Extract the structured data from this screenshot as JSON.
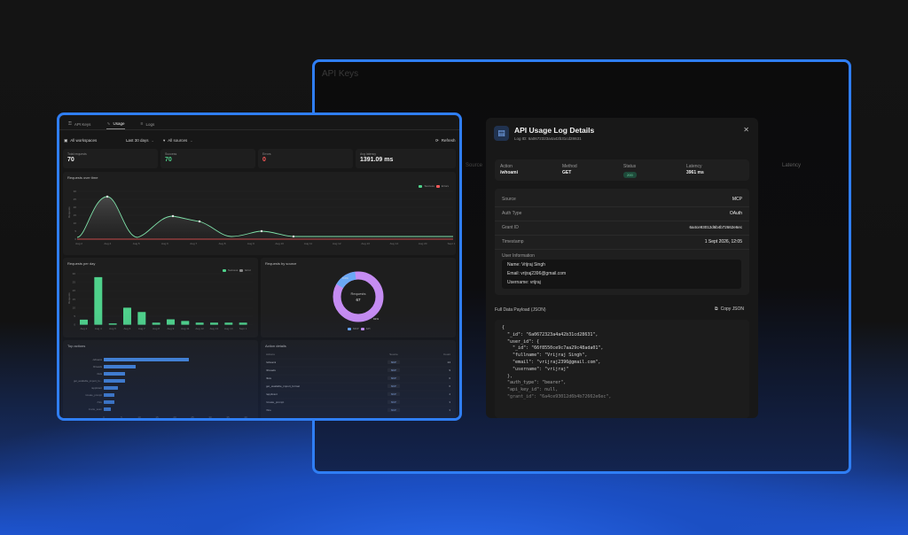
{
  "back_window": {
    "title": "API Keys",
    "source_header": "Source",
    "latency_header": "Latency"
  },
  "dashboard": {
    "tabs": [
      {
        "label": "API Keys",
        "icon": "key-icon"
      },
      {
        "label": "Usage",
        "icon": "chart-icon"
      },
      {
        "label": "Logs",
        "icon": "list-icon"
      }
    ],
    "filters": {
      "workspace": "All workspaces",
      "period": "Last 30 days",
      "sources": "All sources",
      "refresh": "Refresh"
    },
    "stats": [
      {
        "label": "Total requests",
        "value": "70"
      },
      {
        "label": "Success",
        "value": "70",
        "color": "#4fd18b"
      },
      {
        "label": "Errors",
        "value": "0",
        "color": "#ff5a5a"
      },
      {
        "label": "Avg latency",
        "value": "1391.09 ms"
      }
    ],
    "requests_over_time": {
      "title": "Requests over time",
      "legend": [
        "Success",
        "Errors"
      ],
      "ylabel": "Requests",
      "yticks": [
        "30",
        "25",
        "20",
        "15",
        "10",
        "5",
        "0"
      ],
      "xticks": [
        "Aug 2",
        "Aug 4",
        "Aug 5",
        "Aug 6",
        "Aug 7",
        "Aug 8",
        "Aug 9",
        "Aug 10",
        "Aug 11",
        "Aug 12",
        "Aug 13",
        "Aug 14",
        "Aug 20",
        "Sept 1"
      ]
    },
    "requests_per_day": {
      "title": "Requests per day",
      "legend": [
        "Success",
        "Error"
      ],
      "ylabel": "Requests",
      "yticks": [
        "30",
        "25",
        "20",
        "15",
        "10",
        "5",
        "0"
      ],
      "xticks": [
        "Aug 2",
        "Aug 4",
        "Aug 5",
        "Aug 6",
        "Aug 7",
        "Aug 8",
        "Aug 9",
        "Aug 11",
        "Aug 12",
        "Aug 13",
        "Aug 14",
        "Sept 1"
      ]
    },
    "requests_by_source": {
      "title": "Requests by source",
      "center_label": "Requests",
      "center_value": "67",
      "slice_labels": [
        "9.0%",
        "91%"
      ],
      "legend": [
        "MCP",
        "API"
      ]
    },
    "top_actions": {
      "title": "Top actions",
      "labels": [
        "/whoami",
        "/threads",
        "/lists",
        "get_available_import_fo...",
        "/applicant",
        "/create_prompt",
        "/hire",
        "/invite_team"
      ],
      "xticks": [
        "0",
        "5",
        "10",
        "15",
        "20",
        "25",
        "30",
        "35",
        "40"
      ]
    },
    "action_details": {
      "title": "Action details",
      "headers": [
        "Actions",
        "Source",
        "Count"
      ],
      "rows": [
        [
          "/whoami",
          "MCP",
          "24"
        ],
        [
          "/threads",
          "MCP",
          "9"
        ],
        [
          "/lists",
          "MCP",
          "6"
        ],
        [
          "get_available_import_format",
          "MCP",
          "6"
        ],
        [
          "/applicant",
          "MCP",
          "4"
        ],
        [
          "/create_prompt",
          "MCP",
          "3"
        ],
        [
          "/hire",
          "MCP",
          "3"
        ]
      ]
    }
  },
  "modal": {
    "title": "API Usage Log Details",
    "log_id": "Log ID: 6a0672323a4a42b31cd28631",
    "summary": {
      "action_label": "Action",
      "action": "/whoami",
      "method_label": "Method",
      "method": "GET",
      "status_label": "Status",
      "status": "200",
      "latency_label": "Latency",
      "latency": "3961 ms"
    },
    "details": {
      "source_label": "Source",
      "source": "MCP",
      "auth_label": "Auth Type",
      "auth": "OAuth",
      "grant_label": "Grant ID",
      "grant": "6a4ce93012d6b4b72662e6ec",
      "timestamp_label": "Timestamp",
      "timestamp": "1 Sept 2026, 12:05"
    },
    "user_info": {
      "title": "User Information",
      "name": "Name: Vrijraj Singh",
      "email": "Email: vrijraj2396@gmail.com",
      "username": "Username: vrijraj"
    },
    "payload_label": "Full Data Payload (JSON)",
    "copy_label": "Copy JSON",
    "json_text": "{\n  \"_id\": \"6a0672323a4a42b31cd28631\",\n  \"user_id\": {\n    \"_id\": \"66f8550ce9c7aa29c48ada01\",\n    \"fullname\": \"Vrijraj Singh\",\n    \"email\": \"vrijraj2396@gmail.com\",\n    \"username\": \"vrijraj\"\n  },\n  \"auth_type\": \"bearer\",\n  \"api_key_id\": null,\n  \"grant_id\": \"6a4ce93012d6b4b72662e6ec\","
  },
  "colors": {
    "accent": "#2f7ef5",
    "success": "#4fd18b",
    "error": "#ff5a5a",
    "bar": "#4a8fe8",
    "donut_main": "#c58cf2",
    "donut_minor": "#6aa8f5"
  }
}
